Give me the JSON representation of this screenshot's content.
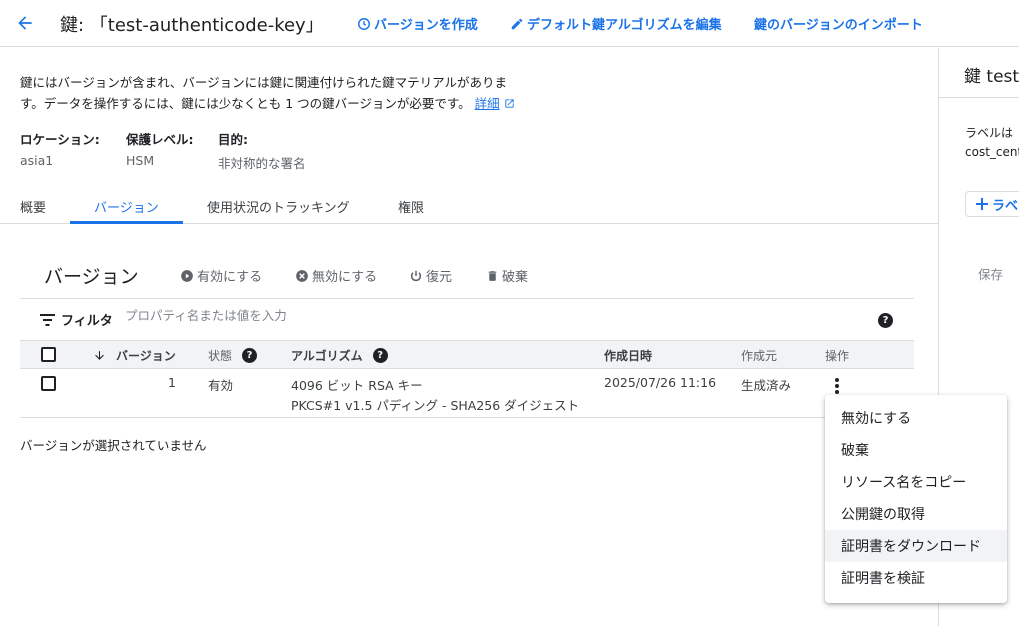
{
  "header": {
    "title": "鍵: 「test-authenticode-key」",
    "actions": [
      "バージョンを作成",
      "デフォルト鍵アルゴリズムを編集",
      "鍵のバージョンのインポート"
    ]
  },
  "description": {
    "line1": "鍵にはバージョンが含まれ、バージョンには鍵に関連付けられた鍵マテリアルがありま",
    "line2": "す。データを操作するには、鍵には少なくとも 1 つの鍵バージョンが必要です。",
    "link": "詳細"
  },
  "properties": [
    {
      "label": "ロケーション:",
      "value": "asia1"
    },
    {
      "label": "保護レベル:",
      "value": "HSM"
    },
    {
      "label": "目的:",
      "value": "非対称的な署名"
    }
  ],
  "tabs": [
    "概要",
    "バージョン",
    "使用状況のトラッキング",
    "権限"
  ],
  "versions": {
    "title": "バージョン",
    "actions": [
      "有効にする",
      "無効にする",
      "復元",
      "破棄"
    ],
    "filter_label": "フィルタ",
    "filter_placeholder": "プロパティ名または値を入力",
    "columns": [
      "バージョン",
      "状態",
      "アルゴリズム",
      "作成日時",
      "作成元",
      "操作"
    ],
    "rows": [
      {
        "version": "1",
        "state": "有効",
        "algorithm_line1": "4096 ビット RSA キー",
        "algorithm_line2": "PKCS#1 v1.5 パディング - SHA256 ダイジェスト",
        "created": "2025/07/26 11:16",
        "source": "生成済み"
      }
    ],
    "none_selected": "バージョンが選択されていません"
  },
  "menu": {
    "items": [
      "無効にする",
      "破棄",
      "リソース名をコピー",
      "公開鍵の取得",
      "証明書をダウンロード",
      "証明書を検証"
    ]
  },
  "right_panel": {
    "title": "鍵 test-",
    "text1": "ラベルは",
    "text2": "cost_cent",
    "button": "ラベ",
    "save": "保存"
  },
  "colors": {
    "accent": "#1a73e8",
    "border": "#dadce0"
  }
}
